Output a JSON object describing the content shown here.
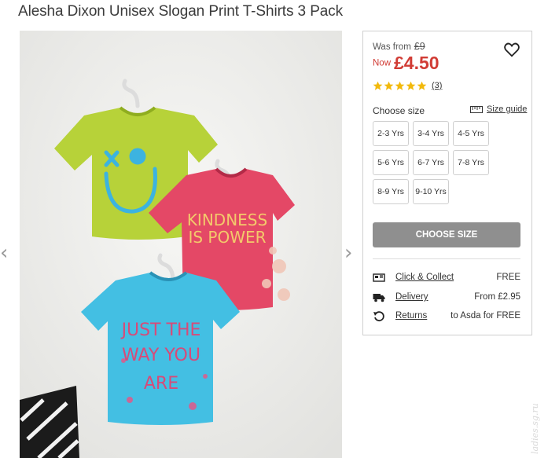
{
  "product": {
    "title": "Alesha Dixon Unisex Slogan Print T-Shirts 3 Pack",
    "image_alt": "Three children's t-shirts on hangers: lime smiley tee, pink KINDNESS IS POWER tee, blue JUST THE WAY YOU ARE tee",
    "slogans": {
      "pink": [
        "KINDNESS",
        "IS POWER"
      ],
      "blue": [
        "JUST THE",
        "WAY YOU",
        "ARE"
      ]
    }
  },
  "gallery": {
    "prev_icon": "chevron-left-icon",
    "next_icon": "chevron-right-icon",
    "prev": "‹",
    "next": "›"
  },
  "pricing": {
    "was_label": "Was from",
    "was_price": "£9",
    "now_label": "Now",
    "now_price": "£4.50",
    "rating": 5,
    "rating_max": 5,
    "review_count": "(3)",
    "accent_color": "#d13c35",
    "star_color": "#f2b90c"
  },
  "size": {
    "label": "Choose size",
    "guide_label": "Size guide",
    "options": [
      "2-3 Yrs",
      "3-4 Yrs",
      "4-5 Yrs",
      "5-6 Yrs",
      "6-7 Yrs",
      "7-8 Yrs",
      "8-9 Yrs",
      "9-10 Yrs"
    ]
  },
  "cta": {
    "label": "CHOOSE SIZE",
    "color": "#8f8f8f"
  },
  "delivery": [
    {
      "icon": "store-icon",
      "label": "Click & Collect",
      "value": "FREE"
    },
    {
      "icon": "truck-icon",
      "label": "Delivery",
      "value": "From £2.95"
    },
    {
      "icon": "returns-icon",
      "label": "Returns",
      "value": "to Asda for FREE"
    }
  ],
  "watermark": "ladies.sg.ru"
}
